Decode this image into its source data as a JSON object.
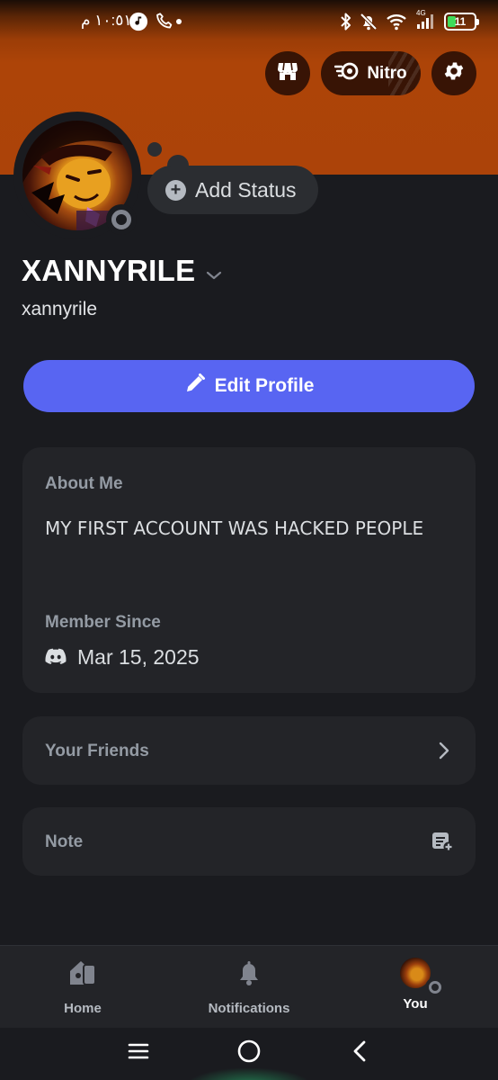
{
  "status_bar": {
    "time": "١٠:٥١ م",
    "icons": [
      "music-icon",
      "phone-icon",
      "bluetooth-icon",
      "mute-icon",
      "wifi-icon",
      "signal-icon"
    ],
    "network": "4G",
    "battery": "11"
  },
  "header": {
    "shop_icon": "shop-icon",
    "nitro_label": "Nitro",
    "settings_icon": "gear-icon"
  },
  "profile": {
    "status_button_label": "Add Status",
    "display_name": "XANNYRILE",
    "username": "xannyrile",
    "edit_button_label": "Edit Profile"
  },
  "about": {
    "heading": "About Me",
    "text": "MY FIRST ACCOUNT WAS HACKED PEOPLE",
    "member_since_heading": "Member Since",
    "member_since_date": "Mar 15, 2025"
  },
  "rows": {
    "friends_label": "Your Friends",
    "note_label": "Note"
  },
  "bottom_nav": {
    "items": [
      {
        "label": "Home",
        "icon": "home-icon"
      },
      {
        "label": "Notifications",
        "icon": "bell-icon"
      },
      {
        "label": "You",
        "icon": "avatar"
      }
    ]
  },
  "colors": {
    "banner": "#ac4309",
    "accent": "#5865f2",
    "background": "#1a1b1f",
    "card": "#232428"
  }
}
